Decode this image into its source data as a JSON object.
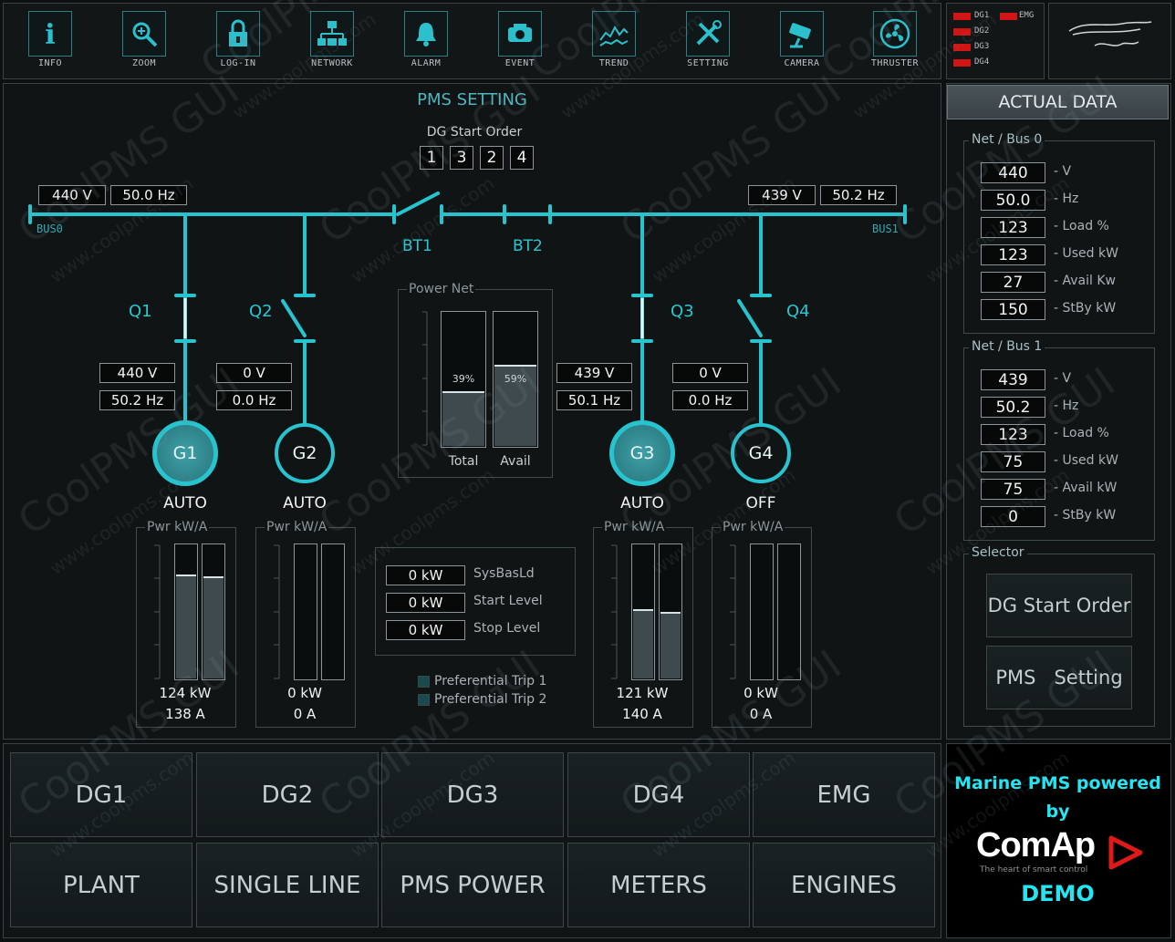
{
  "toolbar": [
    {
      "label": "INFO",
      "icon": "info-icon"
    },
    {
      "label": "ZOOM",
      "icon": "zoom-icon"
    },
    {
      "label": "LOG-IN",
      "icon": "lock-icon"
    },
    {
      "label": "NETWORK",
      "icon": "network-icon"
    },
    {
      "label": "ALARM",
      "icon": "bell-icon"
    },
    {
      "label": "EVENT",
      "icon": "event-icon"
    },
    {
      "label": "TREND",
      "icon": "trend-icon"
    },
    {
      "label": "SETTING",
      "icon": "tools-icon"
    },
    {
      "label": "CAMERA",
      "icon": "camera-icon"
    },
    {
      "label": "THRUSTER",
      "icon": "fan-icon"
    }
  ],
  "status_leds": {
    "dg1": "DG1",
    "dg2": "DG2",
    "dg3": "DG3",
    "dg4": "DG4",
    "emg": "EMG"
  },
  "pms": {
    "title": "PMS SETTING",
    "start_order_label": "DG Start Order",
    "start_order": [
      "1",
      "3",
      "2",
      "4"
    ],
    "bus0": {
      "name": "BUS0",
      "v": "440 V",
      "hz": "50.0 Hz"
    },
    "bus1": {
      "name": "BUS1",
      "v": "439 V",
      "hz": "50.2 Hz"
    },
    "bt1": "BT1",
    "bt2": "BT2",
    "breakers": {
      "q1": "Q1",
      "q2": "Q2",
      "q3": "Q3",
      "q4": "Q4"
    },
    "gens": [
      {
        "name": "G1",
        "v": "440 V",
        "hz": "50.2 Hz",
        "mode": "AUTO",
        "kw": "124 kW",
        "a": "138 A",
        "bar1": 0.76,
        "bar2": 0.74
      },
      {
        "name": "G2",
        "v": "0 V",
        "hz": "0.0 Hz",
        "mode": "AUTO",
        "kw": "0 kW",
        "a": "0 A",
        "bar1": 0,
        "bar2": 0
      },
      {
        "name": "G3",
        "v": "439 V",
        "hz": "50.1 Hz",
        "mode": "AUTO",
        "kw": "121 kW",
        "a": "140 A",
        "bar1": 0.5,
        "bar2": 0.48
      },
      {
        "name": "G4",
        "v": "0 V",
        "hz": "0.0 Hz",
        "mode": "OFF",
        "kw": "0 kW",
        "a": "0 A",
        "bar1": 0,
        "bar2": 0
      }
    ],
    "pwr_title": "Pwr kW/A",
    "power_net": {
      "title": "Power Net",
      "total_label": "Total",
      "avail_label": "Avail",
      "total_pct": "39%",
      "avail_pct": "59%",
      "total": 0.39,
      "avail": 0.59
    },
    "levels": [
      {
        "value": "0 kW",
        "label": "SysBasLd"
      },
      {
        "value": "0 kW",
        "label": "Start Level"
      },
      {
        "value": "0 kW",
        "label": "Stop Level"
      }
    ],
    "pref1": "Preferential Trip  1",
    "pref2": "Preferential Trip  2"
  },
  "actual": {
    "header": "ACTUAL DATA",
    "bus0": {
      "title": "Net / Bus 0",
      "rows": [
        {
          "v": "440",
          "l": "- V"
        },
        {
          "v": "50.0",
          "l": "- Hz"
        },
        {
          "v": "123",
          "l": "- Load %"
        },
        {
          "v": "123",
          "l": "- Used kW"
        },
        {
          "v": "27",
          "l": "- Avail Kw"
        },
        {
          "v": "150",
          "l": "- StBy kW"
        }
      ]
    },
    "bus1": {
      "title": "Net / Bus 1",
      "rows": [
        {
          "v": "439",
          "l": "- V"
        },
        {
          "v": "50.2",
          "l": "- Hz"
        },
        {
          "v": "123",
          "l": "- Load %"
        },
        {
          "v": "75",
          "l": "- Used kW"
        },
        {
          "v": "75",
          "l": "- Avail kW"
        },
        {
          "v": "0",
          "l": "- StBy kW"
        }
      ]
    },
    "selector": {
      "title": "Selector",
      "btn1": "DG Start Order",
      "btn2": "PMS   Setting"
    }
  },
  "nav": {
    "row1": [
      "DG1",
      "DG2",
      "DG3",
      "DG4",
      "EMG"
    ],
    "row2": [
      "PLANT",
      "SINGLE LINE",
      "PMS POWER",
      "METERS",
      "ENGINES"
    ]
  },
  "brand": {
    "line1": "Marine PMS powered",
    "line2": "by",
    "logo": "ComAp",
    "tagline": "The heart of smart control",
    "demo": "DEMO"
  },
  "watermark": {
    "big": "CoolPMS GUI",
    "small": "www.coolpms.com"
  },
  "colors": {
    "accent": "#27c4cf",
    "alarm": "#d11515",
    "brand_cyan": "#22e6f2"
  }
}
